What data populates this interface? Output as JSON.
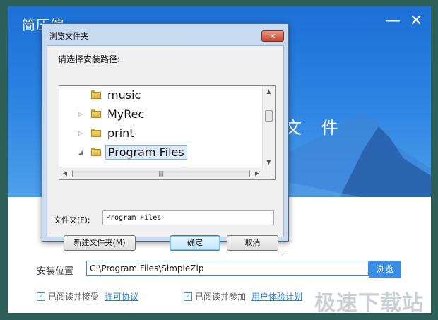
{
  "installer": {
    "title": "简压缩",
    "minimize_glyph": "—",
    "close_glyph": "✕",
    "hero_text": "文 件",
    "install_location_label": "安装位置",
    "install_path": "C:\\Program Files\\SimpleZip",
    "browse_label": "浏览",
    "agree_label": "已阅读并接受",
    "license_link": "许可协议",
    "join_label": "已阅读并参加",
    "ux_link": "用户体验计划",
    "checked": true,
    "watermark": "极速下载站"
  },
  "dialog": {
    "title": "浏览文件夹",
    "close_glyph": "✕",
    "prompt": "请选择安装路径:",
    "tree": [
      {
        "label": "music",
        "arrow": "",
        "selected": false
      },
      {
        "label": "MyRec",
        "arrow": "▷",
        "selected": false
      },
      {
        "label": "print",
        "arrow": "▷",
        "selected": false
      },
      {
        "label": "Program Files",
        "arrow": "◢",
        "selected": true
      }
    ],
    "folder_label": "文件夹(F):",
    "folder_value": "Program Files",
    "new_folder_button": "新建文件夹(M)",
    "ok_button": "确定",
    "cancel_button": "取消"
  },
  "colors": {
    "accent": "#3a8ee6",
    "hero_top": "#1c6fd6",
    "dialog_frame": "#c7daf0"
  }
}
